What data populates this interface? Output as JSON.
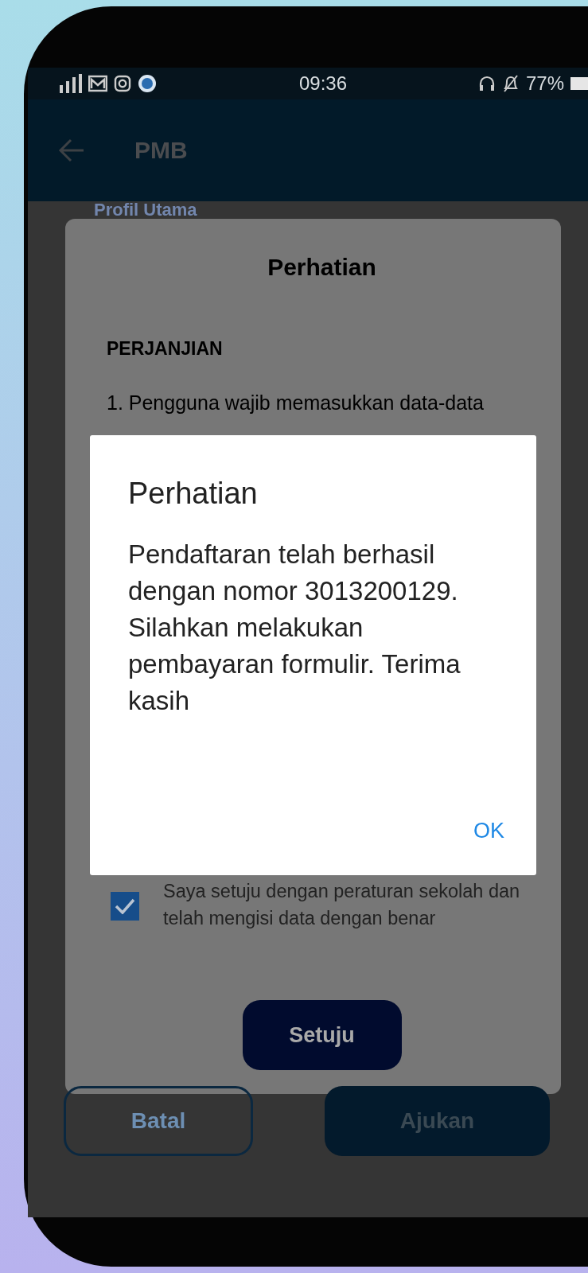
{
  "status_bar": {
    "time": "09:36",
    "battery": "77%"
  },
  "app_bar": {
    "title": "PMB"
  },
  "section_title": "Profil Utama",
  "agreement_sheet": {
    "title": "Perhatian",
    "heading": "PERJANJIAN",
    "items": [
      "1. Pengguna wajib memasukkan data-data"
    ],
    "consent": {
      "label": "Saya setuju dengan peraturan sekolah dan telah mengisi data dengan benar",
      "checked": true
    },
    "button": "Setuju"
  },
  "alert": {
    "title": "Perhatian",
    "message": "Pendaftaran telah berhasil dengan nomor 3013200129. Silahkan melakukan pembayaran formulir. Terima kasih",
    "button": "OK"
  },
  "actions": [
    {
      "label": "Batal",
      "kind": "outlined"
    },
    {
      "label": "Ajukan",
      "kind": "filled"
    }
  ]
}
